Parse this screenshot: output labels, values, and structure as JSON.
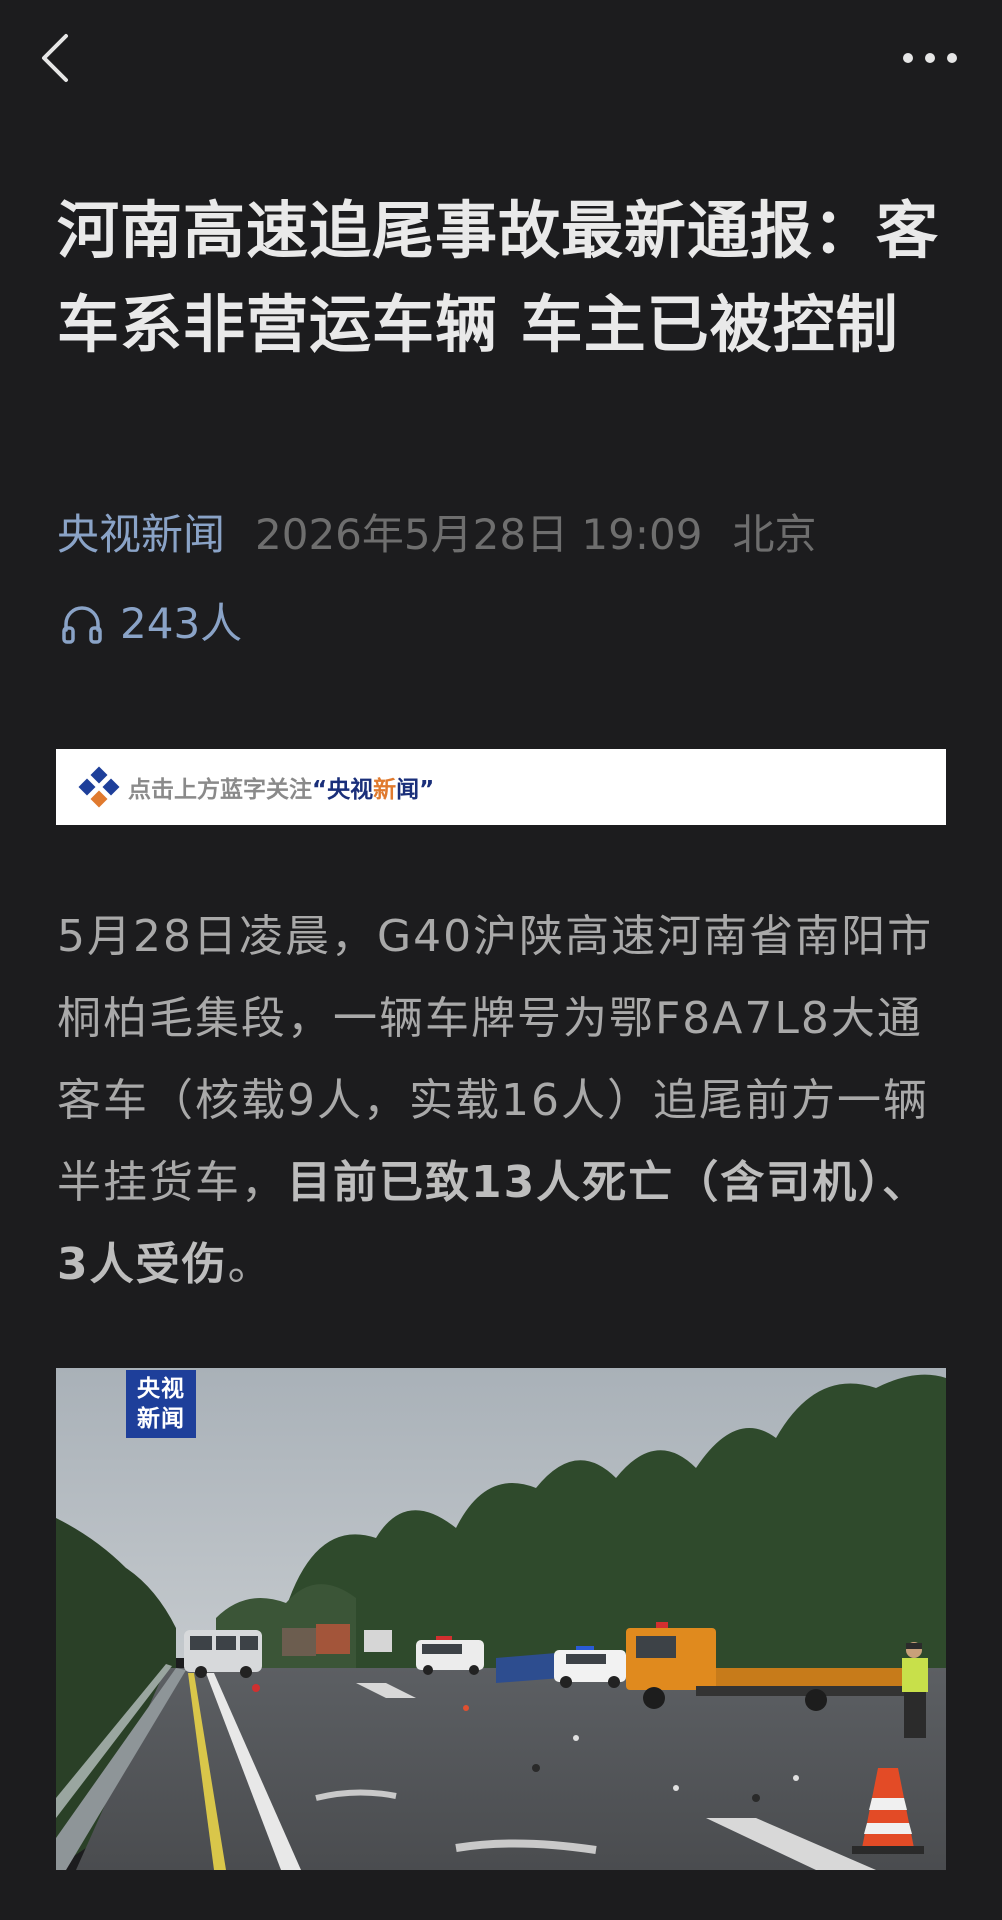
{
  "header": {
    "back_icon": "chevron-left-icon",
    "more_icon": "more-horizontal-icon"
  },
  "article": {
    "title": "河南高速追尾事故最新通报：客车系非营运车辆 车主已被控制",
    "source": "央视新闻",
    "date": "2026年5月28日 19:09",
    "location": "北京",
    "listen_count": "243人",
    "listen_icon": "headphones-icon"
  },
  "banner": {
    "prefix": "点击上方蓝字关注",
    "open_quote": "“",
    "brand_part1": "央视",
    "brand_part2": "新",
    "brand_part3": "闻",
    "close_quote": "”"
  },
  "body": {
    "normal_text": "5月28日凌晨，G40沪陕高速河南省南阳市桐柏毛集段，一辆车牌号为鄂F8A7L8大通客车（核载9人，实载16人）追尾前方一辆半挂货车，",
    "bold_text": "目前已致13人死亡（含司机）、3人受伤",
    "end_text": "。"
  },
  "photo": {
    "watermark": "央视新闻"
  },
  "colors": {
    "background": "#1c1c1e",
    "source_blue": "#8aa3c7",
    "watermark_blue": "#1e3f9a"
  }
}
